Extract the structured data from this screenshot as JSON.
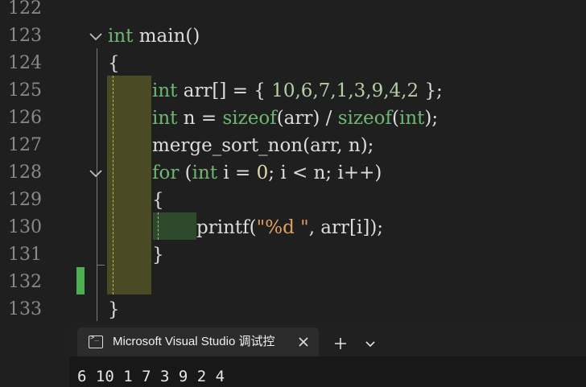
{
  "editor": {
    "lines": [
      {
        "num": "122"
      },
      {
        "num": "123"
      },
      {
        "num": "124"
      },
      {
        "num": "125"
      },
      {
        "num": "126"
      },
      {
        "num": "127"
      },
      {
        "num": "128"
      },
      {
        "num": "129"
      },
      {
        "num": "130"
      },
      {
        "num": "131"
      },
      {
        "num": "132"
      },
      {
        "num": "133"
      }
    ],
    "code": {
      "l123_type": "int",
      "l123_rest": " main()",
      "l124": "{",
      "l125_type": "int",
      "l125_a": " arr[] = { ",
      "l125_nums": "10,6,7,1,3,9,4,2",
      "l125_b": " };",
      "l126_type": "int",
      "l126_a": " n = ",
      "l126_fn1": "sizeof",
      "l126_b": "(arr) / ",
      "l126_fn2": "sizeof",
      "l126_c": "(",
      "l126_type2": "int",
      "l126_d": ");",
      "l127": "merge_sort_non(arr, n);",
      "l128_kw": "for",
      "l128_a": " (",
      "l128_type": "int",
      "l128_b": " i = ",
      "l128_num": "0",
      "l128_c": "; i < n; i++)",
      "l129": "{",
      "l130_fn": "printf",
      "l130_a": "(",
      "l130_str": "\"%d \"",
      "l130_b": ", arr[i]);",
      "l131": "}",
      "l133": "}"
    },
    "colors": {
      "keyword": "#569cd6",
      "type": "#6fb573",
      "number": "#b5cea8",
      "string": "#d69d85",
      "function": "#dcdcaa"
    }
  },
  "terminal": {
    "tab_title": "Microsoft Visual Studio 调试控",
    "tab_icon": "terminal-icon",
    "new_tab_icon": "plus-icon",
    "dropdown_icon": "chevron-down-icon",
    "close_icon": "close-icon",
    "output": "6 10 1 7 3 9 2 4"
  }
}
